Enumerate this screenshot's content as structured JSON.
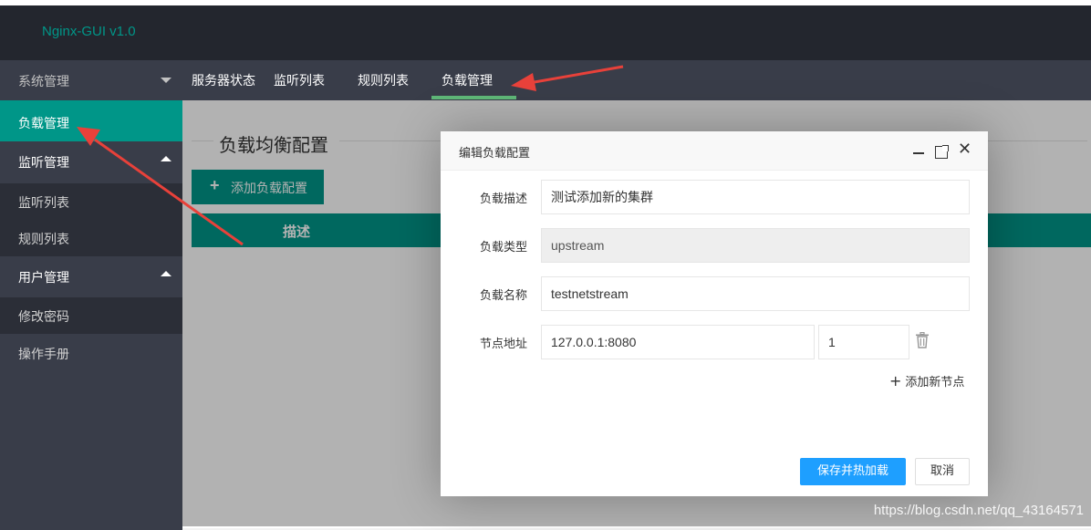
{
  "app": {
    "title": "Nginx-GUI v1.0"
  },
  "sidebar": {
    "items": [
      {
        "label": "系统管理",
        "type": "group",
        "caret": "down"
      },
      {
        "label": "负载管理",
        "type": "item",
        "active": true
      },
      {
        "label": "监听管理",
        "type": "group",
        "caret": "up"
      },
      {
        "label": "监听列表",
        "type": "sub"
      },
      {
        "label": "规则列表",
        "type": "sub"
      },
      {
        "label": "用户管理",
        "type": "group",
        "caret": "up"
      },
      {
        "label": "修改密码",
        "type": "sub"
      },
      {
        "label": "操作手册",
        "type": "item"
      }
    ]
  },
  "topnav": {
    "tabs": [
      {
        "label": "服务器状态"
      },
      {
        "label": "监听列表"
      },
      {
        "label": "规则列表"
      },
      {
        "label": "负载管理",
        "active": true
      }
    ]
  },
  "main": {
    "fieldset_title": "负载均衡配置",
    "add_button": "添加负载配置",
    "table_header": "描述"
  },
  "dialog": {
    "title": "编辑负载配置",
    "fields": [
      {
        "label": "负载描述",
        "value": "测试添加新的集群"
      },
      {
        "label": "负载类型",
        "value": "upstream",
        "disabled": true
      },
      {
        "label": "负载名称",
        "value": "testnetstream"
      },
      {
        "label": "节点地址",
        "value": "127.0.0.1:8080",
        "weight": "1"
      }
    ],
    "add_node": "添加新节点",
    "save_button": "保存并热加载",
    "cancel_button": "取消"
  },
  "watermark": "https://blog.csdn.net/qq_43164571",
  "colors": {
    "accent": "#009688",
    "primary_button": "#1e9fff",
    "annotation": "#e8413a"
  }
}
